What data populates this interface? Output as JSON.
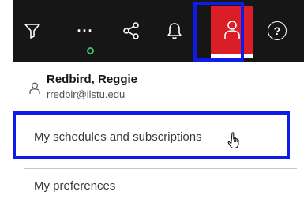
{
  "toolbar": {
    "icons": [
      "filter-icon",
      "more-icon",
      "share-icon",
      "notification-bell-icon",
      "user-icon",
      "help-icon"
    ],
    "active_color": "#da1e28",
    "background": "#161616",
    "more_label": "···",
    "help_label": "?"
  },
  "profile": {
    "name": "Redbird, Reggie",
    "email": "rredbir@ilstu.edu"
  },
  "menu": {
    "schedules_label": "My schedules and subscriptions",
    "preferences_label": "My preferences"
  },
  "highlight_color": "#0f1be8"
}
